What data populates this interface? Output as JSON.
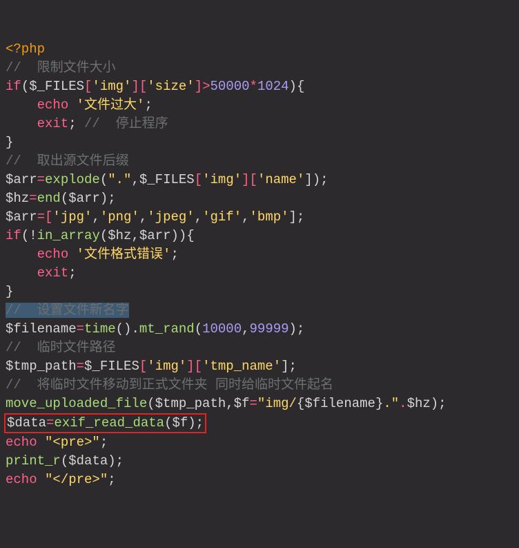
{
  "code": {
    "l1_open": "<?php",
    "l2_cmt": "//  限制文件大小",
    "l3": {
      "a": "if",
      "b": "(",
      "c": "$_FILES",
      "d": "[",
      "e": "'img'",
      "f": "][",
      "g": "'size'",
      "h": "]",
      "i": ">",
      "j": "50000",
      "k": "*",
      "l": "1024",
      "m": "){"
    },
    "l4": {
      "a": "    ",
      "b": "echo",
      "c": " ",
      "d": "'文件过大'",
      "e": ";"
    },
    "l5": {
      "a": "    ",
      "b": "exit",
      "c": "; ",
      "d": "//  停止程序"
    },
    "l6": "}",
    "l7_cmt": "//  取出源文件后缀",
    "l8": {
      "a": "$arr",
      "b": "=",
      "c": "explode",
      "d": "(",
      "e": "\".\"",
      "f": ",",
      "g": "$_FILES",
      "h": "[",
      "i": "'img'",
      "j": "][",
      "k": "'name'",
      "l": "]);"
    },
    "l9": {
      "a": "$hz",
      "b": "=",
      "c": "end",
      "d": "(",
      "e": "$arr",
      "f": ");"
    },
    "l10": {
      "a": "$arr",
      "b": "=[",
      "c": "'jpg'",
      "d": ",",
      "e": "'png'",
      "f": ",",
      "g": "'jpeg'",
      "h": ",",
      "i": "'gif'",
      "j": ",",
      "k": "'bmp'",
      "l": "];"
    },
    "l11": {
      "a": "if",
      "b": "(!",
      "c": "in_array",
      "d": "(",
      "e": "$hz",
      "f": ",",
      "g": "$arr",
      "h": ")){"
    },
    "l12": {
      "a": "    ",
      "b": "echo",
      "c": " ",
      "d": "'文件格式错误'",
      "e": ";"
    },
    "l13": {
      "a": "    ",
      "b": "exit",
      "c": ";"
    },
    "l14": "}",
    "l15_cmt": "//  设置文件新名字",
    "l16": {
      "a": "$filename",
      "b": "=",
      "c": "time",
      "d": "().",
      "e": "mt_rand",
      "f": "(",
      "g": "10000",
      "h": ",",
      "i": "99999",
      "j": ");"
    },
    "l17_cmt": "//  临时文件路径",
    "l18": {
      "a": "$tmp_path",
      "b": "=",
      "c": "$_FILES",
      "d": "[",
      "e": "'img'",
      "f": "][",
      "g": "'tmp_name'",
      "h": "];"
    },
    "l19_cmt": "//  将临时文件移动到正式文件夹 同时给临时文件起名",
    "l20": {
      "a": "move_uploaded_file",
      "b": "(",
      "c": "$tmp_path",
      "d": ",",
      "e": "$f",
      "f": "=",
      "g": "\"img/",
      "h": "{",
      "i": "$filename",
      "j": "}",
      "k": ".\"",
      "l": ".",
      "m": "$hz",
      "n": ");"
    },
    "l21": {
      "a": "$data",
      "b": "=",
      "c": "exif_read_data",
      "d": "(",
      "e": "$f",
      "f": ");"
    },
    "l22": {
      "a": "echo",
      "b": " ",
      "c": "\"<pre>\"",
      "d": ";"
    },
    "l23": {
      "a": "print_r",
      "b": "(",
      "c": "$data",
      "d": ");"
    },
    "l24": {
      "a": "echo",
      "b": " ",
      "c": "\"</pre>\"",
      "d": ";"
    }
  }
}
